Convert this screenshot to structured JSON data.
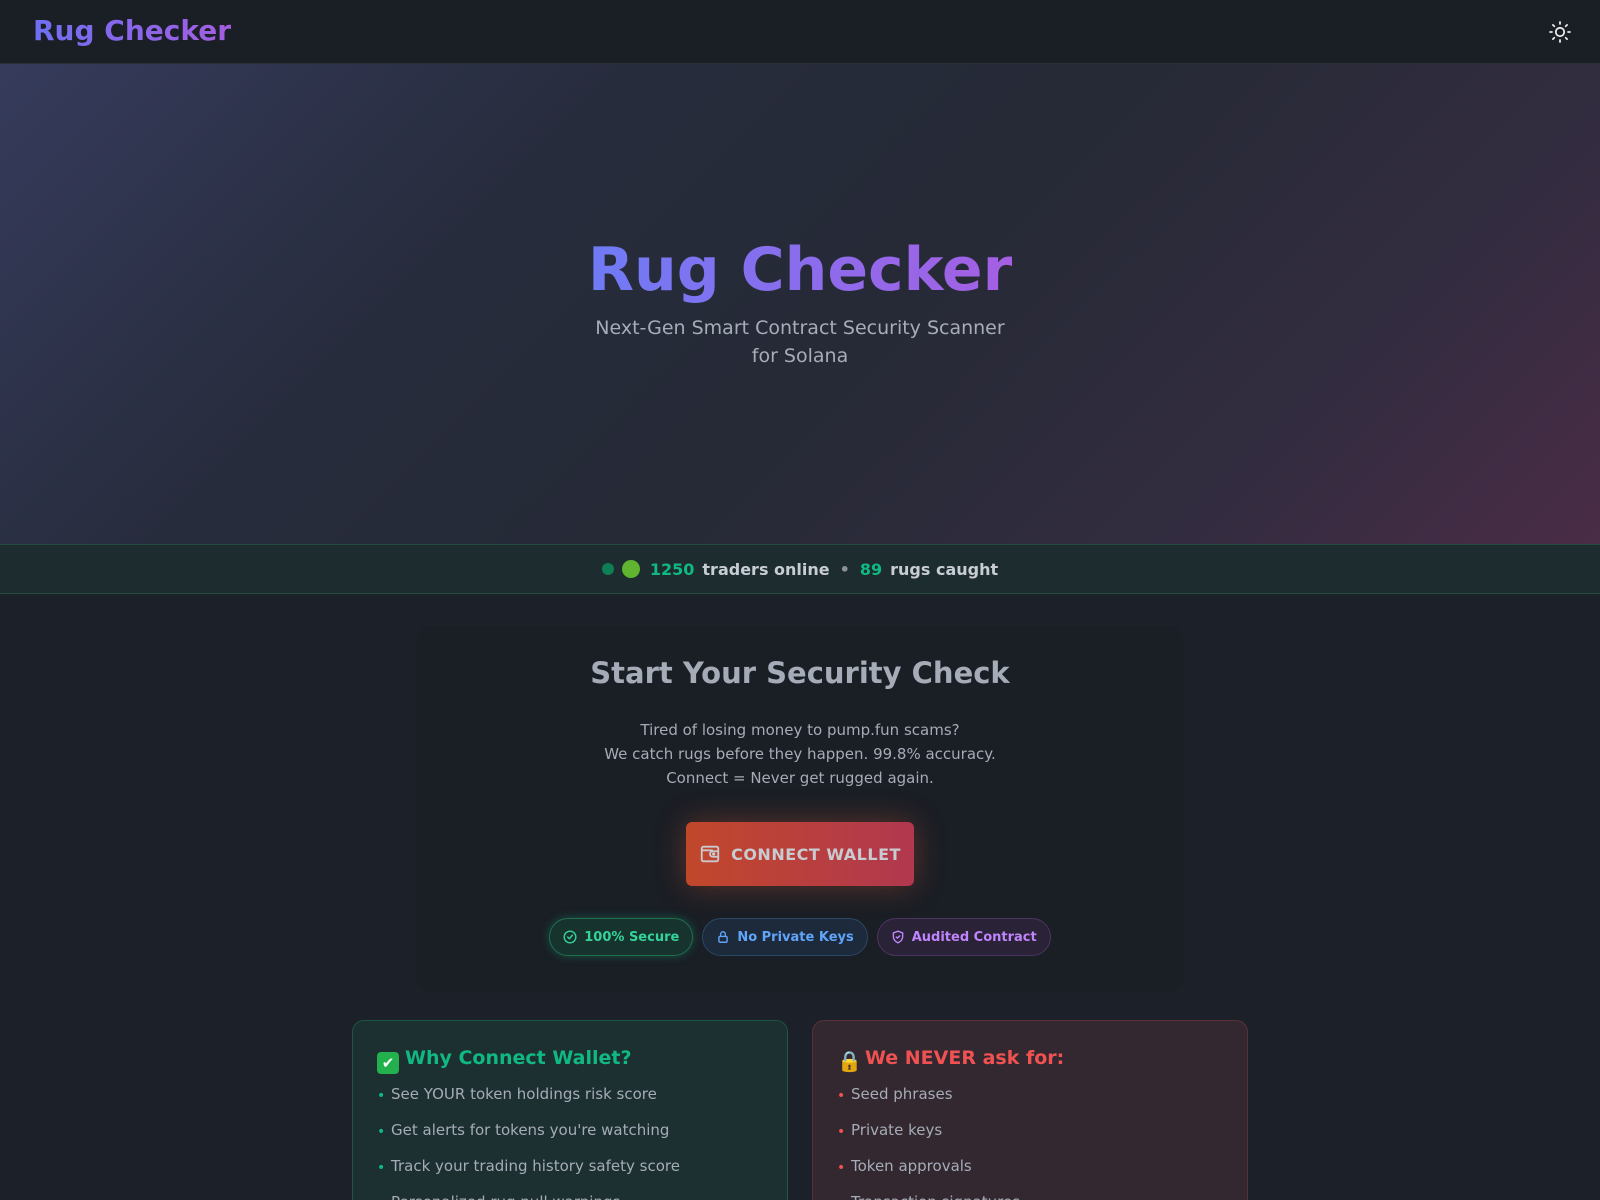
{
  "header": {
    "brand": "Rug Checker",
    "theme_toggle_icon": "sun-icon"
  },
  "hero": {
    "title": "Rug Checker",
    "subtitle": "Next-Gen Smart Contract Security Scanner for Solana"
  },
  "status": {
    "online_count": "1250",
    "online_label": "traders online",
    "separator": "•",
    "rugs_count": "89",
    "rugs_label": "rugs caught"
  },
  "card": {
    "title": "Start Your Security Check",
    "desc_line1": "Tired of losing money to pump.fun scams?",
    "desc_line2": "We catch rugs before they happen. 99.8% accuracy.",
    "desc_line3": "Connect = Never get rugged again.",
    "connect_label": "CONNECT WALLET",
    "badges": [
      {
        "label": "100% Secure",
        "icon": "check-circle-icon"
      },
      {
        "label": "No Private Keys",
        "icon": "lock-icon"
      },
      {
        "label": "Audited Contract",
        "icon": "shield-check-icon"
      }
    ]
  },
  "why_panel": {
    "emoji": "✔",
    "title": "Why Connect Wallet?",
    "items": [
      "See YOUR token holdings risk score",
      "Get alerts for tokens you're watching",
      "Track your trading history safety score",
      "Personalized rug pull warnings"
    ]
  },
  "never_panel": {
    "emoji": "🔒",
    "title": "We NEVER ask for:",
    "items": [
      "Seed phrases",
      "Private keys",
      "Token approvals",
      "Transaction signatures"
    ]
  },
  "colors": {
    "accent_green": "#10b981",
    "accent_red": "#f05252",
    "brand_start": "#6f6ff2",
    "brand_end": "#a35ee0"
  }
}
